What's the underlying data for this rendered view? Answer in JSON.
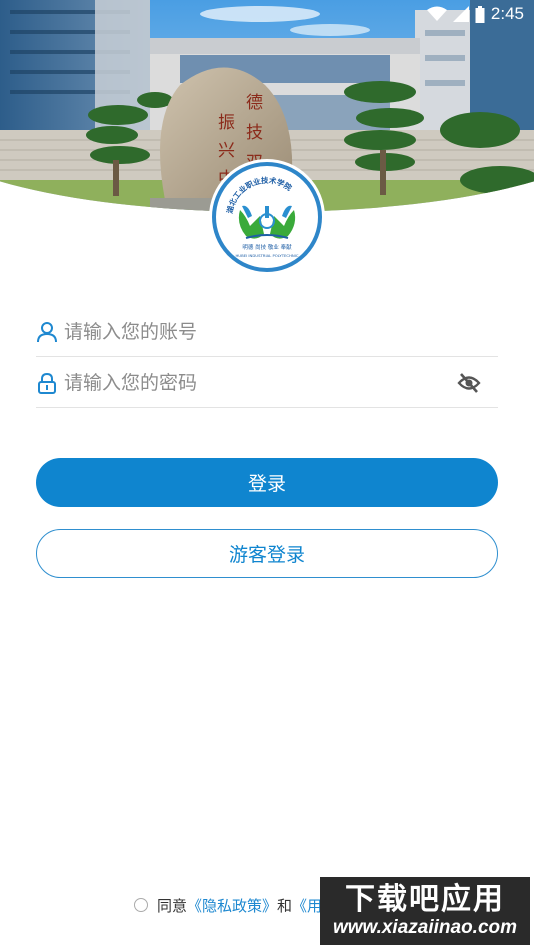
{
  "status_bar": {
    "time": "2:45",
    "icons": [
      "wifi-icon",
      "signal-icon",
      "battery-icon"
    ]
  },
  "header": {
    "image": "campus-stone-monument-photo",
    "stone_inscription": "振兴中华 德技双"
  },
  "emblem": {
    "icon": "school-emblem-hands-logo",
    "arc_text": "湖北工业职业技术学院",
    "motto": "明德 尚技 敬业 奉献",
    "english": "HUBEI INDUSTRIAL POLYTECHNIC"
  },
  "login_form": {
    "account": {
      "placeholder": "请输入您的账号",
      "icon": "user-icon"
    },
    "password": {
      "placeholder": "请输入您的密码",
      "icon": "lock-icon",
      "toggle_icon": "eye-off-icon"
    },
    "login_label": "登录",
    "guest_label": "游客登录"
  },
  "agreement": {
    "prefix": "同意",
    "privacy": "《隐私政策》",
    "and": "和",
    "terms": "《用户协议》"
  },
  "watermark": {
    "brand": "下载吧应用",
    "url": "www.xiazaiinao.com"
  },
  "colors": {
    "primary": "#0f85cf",
    "link": "#1e88d0",
    "placeholder": "#8c8c8c",
    "divider": "#e3e3e3"
  }
}
